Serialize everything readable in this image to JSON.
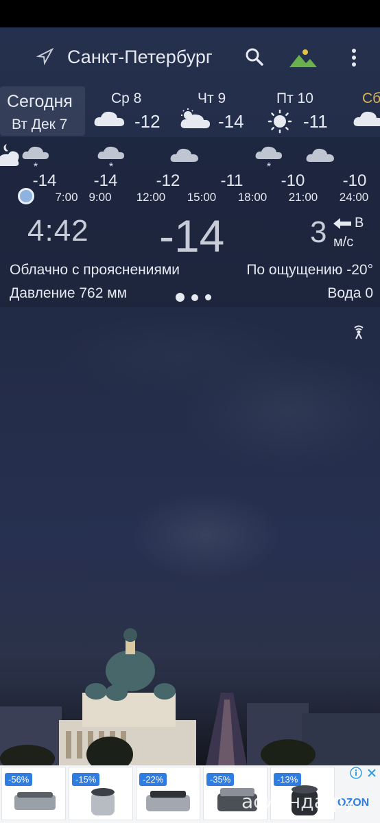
{
  "header": {
    "city": "Санкт-Петербург"
  },
  "days": {
    "today_title": "Сегодня",
    "today_date": "Вт Дек 7",
    "items": [
      {
        "name": "Ср 8",
        "temp": "-12",
        "icon": "cloud-icon"
      },
      {
        "name": "Чт 9",
        "temp": "-14",
        "icon": "partly-cloudy-icon"
      },
      {
        "name": "Пт 10",
        "temp": "-11",
        "icon": "sun-icon"
      },
      {
        "name": "Сб",
        "icon": "cloud-icon"
      }
    ]
  },
  "hourly": [
    {
      "temp": "-14",
      "time": "7:00",
      "icon": "snow-cloud-icon"
    },
    {
      "temp": "-14",
      "time": "9:00",
      "icon": "snow-cloud-icon"
    },
    {
      "temp": "-12",
      "time": "12:00",
      "icon": "cloud-icon"
    },
    {
      "temp": "-11",
      "time": "15:00",
      "icon": "none"
    },
    {
      "temp": "-10",
      "time": "18:00",
      "icon": "snow-cloud-icon"
    },
    {
      "temp": "-10",
      "time": "21:00",
      "icon": "cloud-icon"
    },
    {
      "temp": "-10",
      "time": "24:00",
      "icon": "none"
    }
  ],
  "current": {
    "time": "4:42",
    "temp": "-14",
    "wind_speed": "3",
    "wind_dir": "В",
    "wind_unit": "м/с",
    "condition": "Облачно с прояснениями",
    "feels_like": "По ощущению -20°",
    "pressure": "Давление 762 мм",
    "water": "Вода 0"
  },
  "ad": {
    "items": [
      {
        "badge": "-56%"
      },
      {
        "badge": "-15%"
      },
      {
        "badge": "-22%"
      },
      {
        "badge": "-35%"
      },
      {
        "badge": "-13%"
      }
    ],
    "brand": "OZON",
    "watermark": "асиенда.ру"
  },
  "colors": {
    "accent_sat": "#d9b35a",
    "ad_badge": "#2f7de1"
  }
}
